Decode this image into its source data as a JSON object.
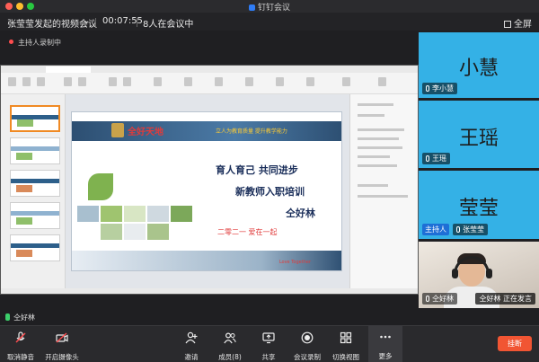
{
  "window": {
    "title": "钉钉会议"
  },
  "meeting": {
    "name": "张莹莹发起的视频会议",
    "duration": "00:07:55",
    "attendance": "8人在会议中",
    "fullscreen_label": "全屏"
  },
  "recording": {
    "label": "主持人录制中"
  },
  "slide": {
    "school": "全好天地",
    "motto": "立人为教育质量 提升教学能力",
    "line1": "育人育己  共同进步",
    "line2": "新教师入职培训",
    "line3": "仝好林",
    "year": "二零二一  爱在一起",
    "tag": "Love Together"
  },
  "participants": [
    {
      "display": "小慧",
      "name": "李小慧"
    },
    {
      "display": "王瑶",
      "name": "王瑶"
    },
    {
      "display": "莹莹",
      "host_tag": "主持人",
      "name": "张莹莹"
    }
  ],
  "video_tile": {
    "name": "仝好林",
    "status": "正在发言"
  },
  "speaker": {
    "name": "仝好林"
  },
  "toolbar": {
    "unmute": "取消静音",
    "camera": "开启摄像头",
    "invite": "邀请",
    "members": "成员(8)",
    "share": "共享",
    "record": "会议录制",
    "switch_view": "切换视图",
    "more": "更多",
    "leave": "挂断"
  },
  "colors": {
    "tile_blue": "#34b1e6",
    "leave_red": "#f15533",
    "host_blue": "#1e6fd6"
  }
}
